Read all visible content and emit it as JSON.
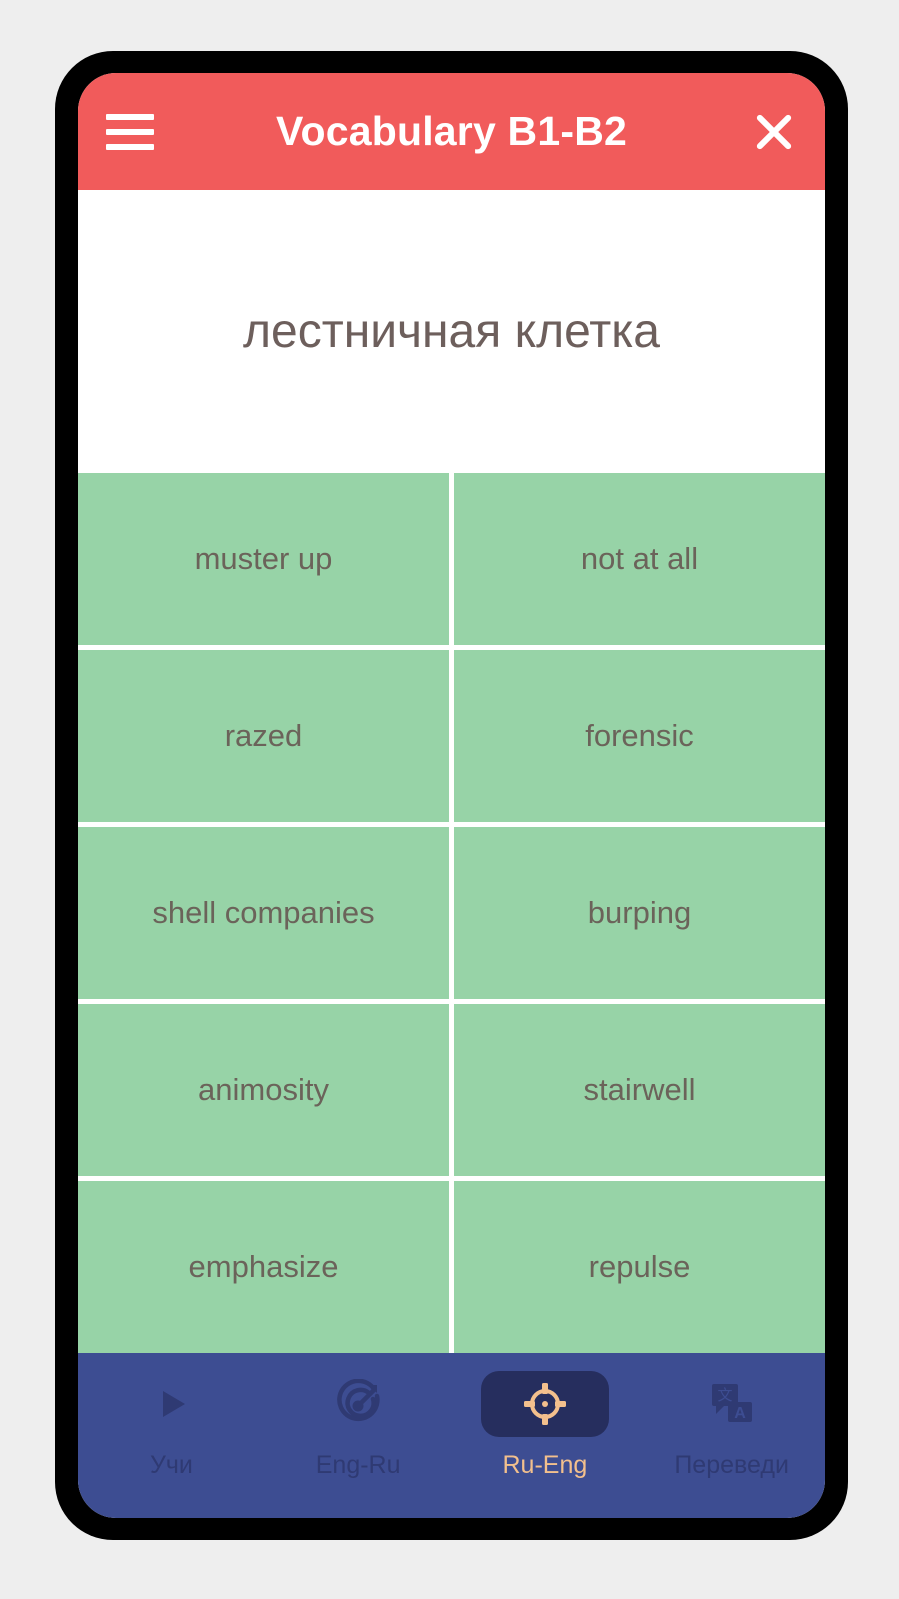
{
  "app": {
    "title": "Vocabulary B1-B2",
    "menu_icon": "hamburger-menu-icon",
    "close_icon": "close-icon",
    "header_color": "#f15b5b"
  },
  "prompt": {
    "word": "лестничная клетка",
    "text_color": "#6d5f5c",
    "background": "#ffffff"
  },
  "answers": {
    "tile_color": "#97d3a7",
    "tile_text_color": "#6b635a",
    "options": [
      {
        "label": "muster up"
      },
      {
        "label": "not at all"
      },
      {
        "label": "razed"
      },
      {
        "label": "forensic"
      },
      {
        "label": "shell companies"
      },
      {
        "label": "burping"
      },
      {
        "label": "animosity"
      },
      {
        "label": "stairwell"
      },
      {
        "label": "emphasize"
      },
      {
        "label": "repulse"
      }
    ]
  },
  "bottom_nav": {
    "background": "#3d4d92",
    "active_pill_color": "#262e5e",
    "active_accent_color": "#f3c08d",
    "inactive_color": "#2f3a73",
    "items": [
      {
        "label": "Учи",
        "icon": "play-icon",
        "active": false
      },
      {
        "label": "Eng-Ru",
        "icon": "target-dart-icon",
        "active": false
      },
      {
        "label": "Ru-Eng",
        "icon": "crosshair-icon",
        "active": true
      },
      {
        "label": "Переведи",
        "icon": "translate-icon",
        "active": false
      }
    ]
  }
}
